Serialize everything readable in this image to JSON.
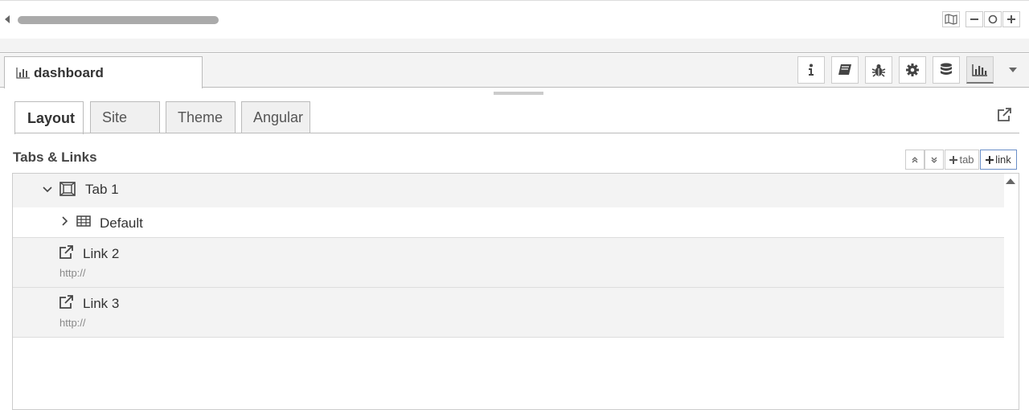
{
  "sidebar": {
    "tab_label": "dashboard",
    "tool_buttons": [
      {
        "name": "info-icon"
      },
      {
        "name": "book-icon"
      },
      {
        "name": "bug-icon"
      },
      {
        "name": "gear-icon"
      },
      {
        "name": "database-icon"
      },
      {
        "name": "bar-chart-icon",
        "active": true
      }
    ]
  },
  "content_tabs": [
    {
      "label": "Layout",
      "active": true
    },
    {
      "label": "Site"
    },
    {
      "label": "Theme"
    },
    {
      "label": "Angular"
    }
  ],
  "section": {
    "title": "Tabs & Links",
    "add_tab_label": "tab",
    "add_link_label": "link"
  },
  "tree": [
    {
      "type": "tab",
      "label": "Tab 1",
      "expanded": true
    },
    {
      "type": "group",
      "label": "Default",
      "expanded": false
    },
    {
      "type": "link",
      "label": "Link 2",
      "url": "http://"
    },
    {
      "type": "link",
      "label": "Link 3",
      "url": "http://"
    }
  ]
}
